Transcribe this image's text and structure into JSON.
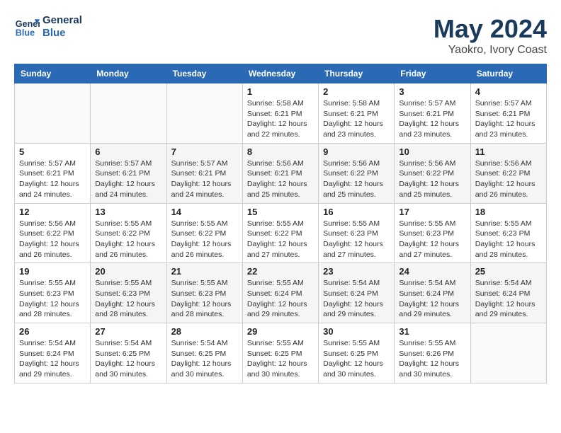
{
  "header": {
    "logo_line1": "General",
    "logo_line2": "Blue",
    "month_title": "May 2024",
    "location": "Yaokro, Ivory Coast"
  },
  "days_of_week": [
    "Sunday",
    "Monday",
    "Tuesday",
    "Wednesday",
    "Thursday",
    "Friday",
    "Saturday"
  ],
  "weeks": [
    {
      "days": [
        {
          "num": "",
          "info": ""
        },
        {
          "num": "",
          "info": ""
        },
        {
          "num": "",
          "info": ""
        },
        {
          "num": "1",
          "info": "Sunrise: 5:58 AM\nSunset: 6:21 PM\nDaylight: 12 hours\nand 22 minutes."
        },
        {
          "num": "2",
          "info": "Sunrise: 5:58 AM\nSunset: 6:21 PM\nDaylight: 12 hours\nand 23 minutes."
        },
        {
          "num": "3",
          "info": "Sunrise: 5:57 AM\nSunset: 6:21 PM\nDaylight: 12 hours\nand 23 minutes."
        },
        {
          "num": "4",
          "info": "Sunrise: 5:57 AM\nSunset: 6:21 PM\nDaylight: 12 hours\nand 23 minutes."
        }
      ]
    },
    {
      "days": [
        {
          "num": "5",
          "info": "Sunrise: 5:57 AM\nSunset: 6:21 PM\nDaylight: 12 hours\nand 24 minutes."
        },
        {
          "num": "6",
          "info": "Sunrise: 5:57 AM\nSunset: 6:21 PM\nDaylight: 12 hours\nand 24 minutes."
        },
        {
          "num": "7",
          "info": "Sunrise: 5:57 AM\nSunset: 6:21 PM\nDaylight: 12 hours\nand 24 minutes."
        },
        {
          "num": "8",
          "info": "Sunrise: 5:56 AM\nSunset: 6:21 PM\nDaylight: 12 hours\nand 25 minutes."
        },
        {
          "num": "9",
          "info": "Sunrise: 5:56 AM\nSunset: 6:22 PM\nDaylight: 12 hours\nand 25 minutes."
        },
        {
          "num": "10",
          "info": "Sunrise: 5:56 AM\nSunset: 6:22 PM\nDaylight: 12 hours\nand 25 minutes."
        },
        {
          "num": "11",
          "info": "Sunrise: 5:56 AM\nSunset: 6:22 PM\nDaylight: 12 hours\nand 26 minutes."
        }
      ]
    },
    {
      "days": [
        {
          "num": "12",
          "info": "Sunrise: 5:56 AM\nSunset: 6:22 PM\nDaylight: 12 hours\nand 26 minutes."
        },
        {
          "num": "13",
          "info": "Sunrise: 5:55 AM\nSunset: 6:22 PM\nDaylight: 12 hours\nand 26 minutes."
        },
        {
          "num": "14",
          "info": "Sunrise: 5:55 AM\nSunset: 6:22 PM\nDaylight: 12 hours\nand 26 minutes."
        },
        {
          "num": "15",
          "info": "Sunrise: 5:55 AM\nSunset: 6:22 PM\nDaylight: 12 hours\nand 27 minutes."
        },
        {
          "num": "16",
          "info": "Sunrise: 5:55 AM\nSunset: 6:23 PM\nDaylight: 12 hours\nand 27 minutes."
        },
        {
          "num": "17",
          "info": "Sunrise: 5:55 AM\nSunset: 6:23 PM\nDaylight: 12 hours\nand 27 minutes."
        },
        {
          "num": "18",
          "info": "Sunrise: 5:55 AM\nSunset: 6:23 PM\nDaylight: 12 hours\nand 28 minutes."
        }
      ]
    },
    {
      "days": [
        {
          "num": "19",
          "info": "Sunrise: 5:55 AM\nSunset: 6:23 PM\nDaylight: 12 hours\nand 28 minutes."
        },
        {
          "num": "20",
          "info": "Sunrise: 5:55 AM\nSunset: 6:23 PM\nDaylight: 12 hours\nand 28 minutes."
        },
        {
          "num": "21",
          "info": "Sunrise: 5:55 AM\nSunset: 6:23 PM\nDaylight: 12 hours\nand 28 minutes."
        },
        {
          "num": "22",
          "info": "Sunrise: 5:55 AM\nSunset: 6:24 PM\nDaylight: 12 hours\nand 29 minutes."
        },
        {
          "num": "23",
          "info": "Sunrise: 5:54 AM\nSunset: 6:24 PM\nDaylight: 12 hours\nand 29 minutes."
        },
        {
          "num": "24",
          "info": "Sunrise: 5:54 AM\nSunset: 6:24 PM\nDaylight: 12 hours\nand 29 minutes."
        },
        {
          "num": "25",
          "info": "Sunrise: 5:54 AM\nSunset: 6:24 PM\nDaylight: 12 hours\nand 29 minutes."
        }
      ]
    },
    {
      "days": [
        {
          "num": "26",
          "info": "Sunrise: 5:54 AM\nSunset: 6:24 PM\nDaylight: 12 hours\nand 29 minutes."
        },
        {
          "num": "27",
          "info": "Sunrise: 5:54 AM\nSunset: 6:25 PM\nDaylight: 12 hours\nand 30 minutes."
        },
        {
          "num": "28",
          "info": "Sunrise: 5:54 AM\nSunset: 6:25 PM\nDaylight: 12 hours\nand 30 minutes."
        },
        {
          "num": "29",
          "info": "Sunrise: 5:55 AM\nSunset: 6:25 PM\nDaylight: 12 hours\nand 30 minutes."
        },
        {
          "num": "30",
          "info": "Sunrise: 5:55 AM\nSunset: 6:25 PM\nDaylight: 12 hours\nand 30 minutes."
        },
        {
          "num": "31",
          "info": "Sunrise: 5:55 AM\nSunset: 6:26 PM\nDaylight: 12 hours\nand 30 minutes."
        },
        {
          "num": "",
          "info": ""
        }
      ]
    }
  ]
}
